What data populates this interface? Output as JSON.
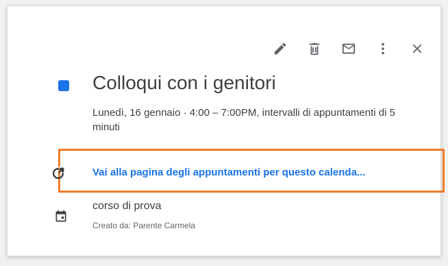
{
  "toolbar": {
    "icons": [
      "pencil-icon",
      "trash-icon",
      "mail-icon",
      "more-vert-icon",
      "close-icon"
    ]
  },
  "event": {
    "color": "#1a73e8",
    "title": "Colloqui con i genitori",
    "datetime": "Lunedì, 16 gennaio  ·  4:00 – 7:00PM, intervalli di appuntamenti di 5 minuti"
  },
  "booking": {
    "link_text": "Vai alla pagina degli appuntamenti per questo calenda...",
    "highlight_color": "#f07a28"
  },
  "calendar": {
    "name": "corso di prova",
    "created_by": "Creato da: Parente Carmela"
  }
}
